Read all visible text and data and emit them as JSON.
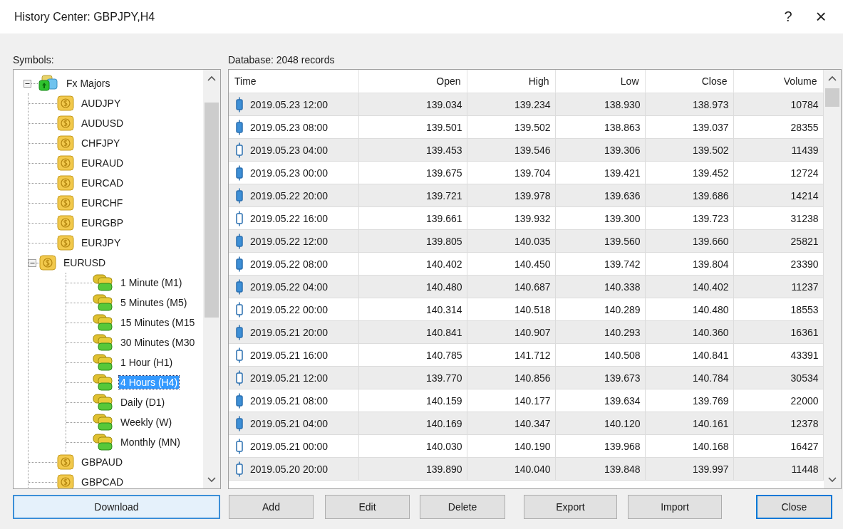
{
  "window": {
    "title": "History Center: GBPJPY,H4",
    "help": "?",
    "close": "×"
  },
  "symbols": {
    "label": "Symbols:",
    "tree": [
      {
        "label": "Fx Majors",
        "expanded": true,
        "selected": false,
        "children": [
          {
            "label": "AUDJPY",
            "selected": false
          },
          {
            "label": "AUDUSD",
            "selected": false
          },
          {
            "label": "CHFJPY",
            "selected": false
          },
          {
            "label": "EURAUD",
            "selected": false
          },
          {
            "label": "EURCAD",
            "selected": false
          },
          {
            "label": "EURCHF",
            "selected": false
          },
          {
            "label": "EURGBP",
            "selected": false
          },
          {
            "label": "EURJPY",
            "selected": false
          },
          {
            "label": "EURUSD",
            "expanded": true,
            "selected": false,
            "children": [
              {
                "label": "1 Minute (M1)",
                "selected": false
              },
              {
                "label": "5 Minutes (M5)",
                "selected": false
              },
              {
                "label": "15 Minutes (M15",
                "selected": false
              },
              {
                "label": "30 Minutes (M30",
                "selected": false
              },
              {
                "label": "1 Hour (H1)",
                "selected": false
              },
              {
                "label": "4 Hours (H4)",
                "selected": true
              },
              {
                "label": "Daily (D1)",
                "selected": false
              },
              {
                "label": "Weekly (W)",
                "selected": false
              },
              {
                "label": "Monthly (MN)",
                "selected": false
              }
            ]
          },
          {
            "label": "GBPAUD",
            "selected": false
          },
          {
            "label": "GBPCAD",
            "selected": false
          }
        ]
      }
    ]
  },
  "database": {
    "label": "Database: 2048 records"
  },
  "table": {
    "columns": [
      "Time",
      "Open",
      "High",
      "Low",
      "Close",
      "Volume"
    ],
    "rows": [
      {
        "filled": true,
        "cells": [
          "2019.05.23 12:00",
          "139.034",
          "139.234",
          "138.930",
          "138.973",
          "10784"
        ]
      },
      {
        "filled": true,
        "cells": [
          "2019.05.23 08:00",
          "139.501",
          "139.502",
          "138.863",
          "139.037",
          "28355"
        ]
      },
      {
        "filled": false,
        "cells": [
          "2019.05.23 04:00",
          "139.453",
          "139.546",
          "139.306",
          "139.502",
          "11439"
        ]
      },
      {
        "filled": true,
        "cells": [
          "2019.05.23 00:00",
          "139.675",
          "139.704",
          "139.421",
          "139.452",
          "12724"
        ]
      },
      {
        "filled": true,
        "cells": [
          "2019.05.22 20:00",
          "139.721",
          "139.978",
          "139.636",
          "139.686",
          "14214"
        ]
      },
      {
        "filled": false,
        "cells": [
          "2019.05.22 16:00",
          "139.661",
          "139.932",
          "139.300",
          "139.723",
          "31238"
        ]
      },
      {
        "filled": true,
        "cells": [
          "2019.05.22 12:00",
          "139.805",
          "140.035",
          "139.560",
          "139.660",
          "25821"
        ]
      },
      {
        "filled": true,
        "cells": [
          "2019.05.22 08:00",
          "140.402",
          "140.450",
          "139.742",
          "139.804",
          "23390"
        ]
      },
      {
        "filled": true,
        "cells": [
          "2019.05.22 04:00",
          "140.480",
          "140.687",
          "140.338",
          "140.402",
          "11237"
        ]
      },
      {
        "filled": false,
        "cells": [
          "2019.05.22 00:00",
          "140.314",
          "140.518",
          "140.289",
          "140.480",
          "18553"
        ]
      },
      {
        "filled": true,
        "cells": [
          "2019.05.21 20:00",
          "140.841",
          "140.907",
          "140.293",
          "140.360",
          "16361"
        ]
      },
      {
        "filled": false,
        "cells": [
          "2019.05.21 16:00",
          "140.785",
          "141.712",
          "140.508",
          "140.841",
          "43391"
        ]
      },
      {
        "filled": false,
        "cells": [
          "2019.05.21 12:00",
          "139.770",
          "140.856",
          "139.673",
          "140.784",
          "30534"
        ]
      },
      {
        "filled": true,
        "cells": [
          "2019.05.21 08:00",
          "140.159",
          "140.177",
          "139.634",
          "139.769",
          "22000"
        ]
      },
      {
        "filled": true,
        "cells": [
          "2019.05.21 04:00",
          "140.169",
          "140.347",
          "140.120",
          "140.161",
          "12378"
        ]
      },
      {
        "filled": false,
        "cells": [
          "2019.05.21 00:00",
          "140.030",
          "140.190",
          "139.968",
          "140.168",
          "16427"
        ]
      },
      {
        "filled": false,
        "cells": [
          "2019.05.20 20:00",
          "139.890",
          "140.040",
          "139.848",
          "139.997",
          "11448"
        ]
      }
    ]
  },
  "buttons": [
    {
      "label": "Download",
      "kind": "focused"
    },
    {
      "label": "Add",
      "kind": "normal"
    },
    {
      "label": "Edit",
      "kind": "normal"
    },
    {
      "label": "Delete",
      "kind": "normal"
    },
    {
      "label": "Export",
      "kind": "normal"
    },
    {
      "label": "Import",
      "kind": "normal"
    },
    {
      "label": "Close",
      "kind": "default"
    }
  ]
}
